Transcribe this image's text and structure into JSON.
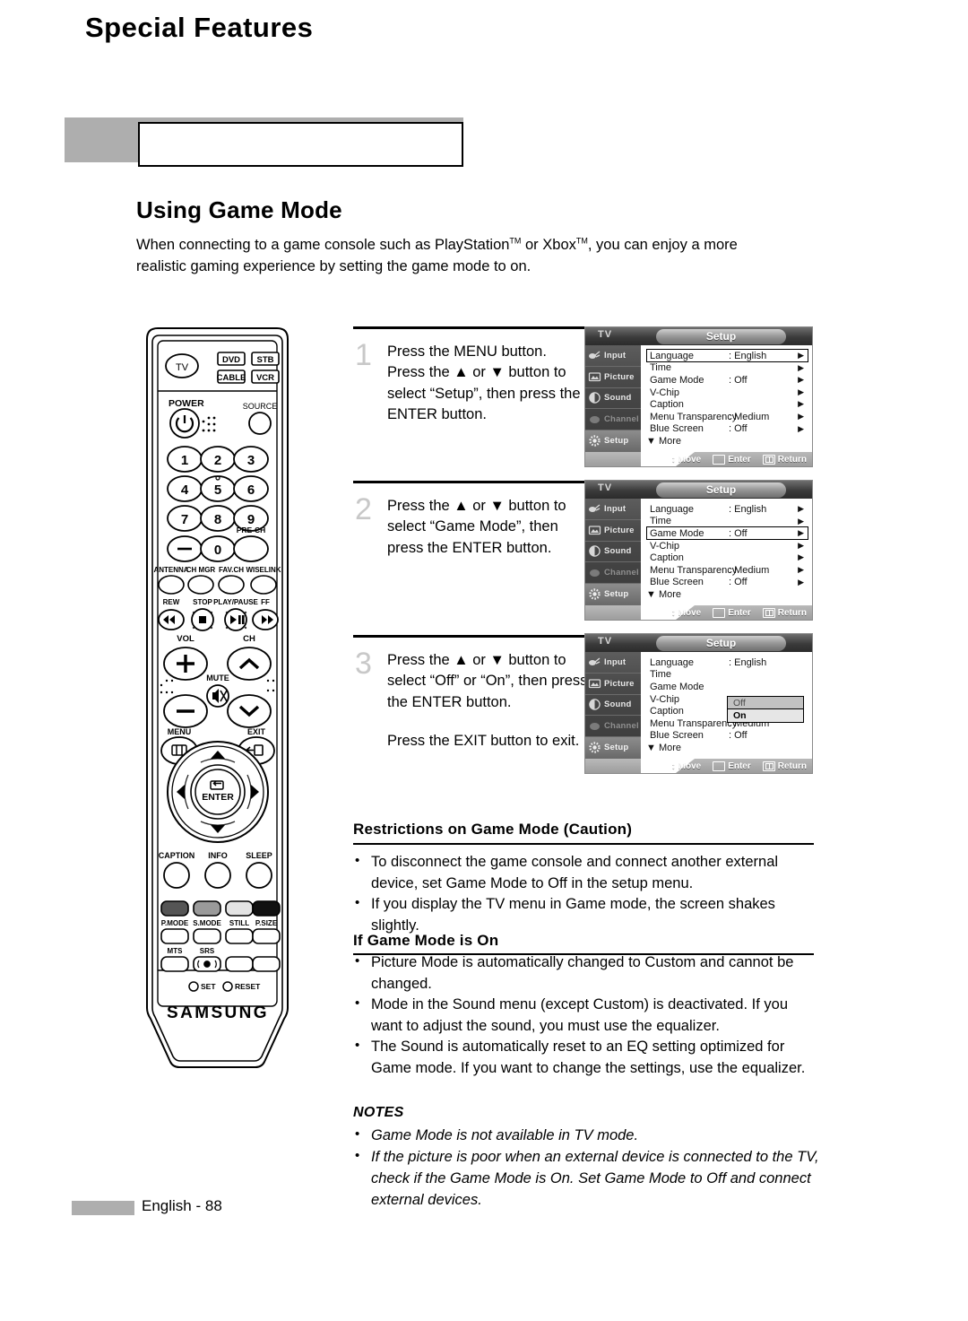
{
  "header": {
    "title": "Special Features"
  },
  "section": {
    "title": "Using Game Mode",
    "intro": "When connecting to a game console such as PlayStation™ or Xbox™, you can enjoy a more realistic gaming experience by setting the game mode to on."
  },
  "steps": [
    {
      "num": "1",
      "text": "Press the MENU button. Press the ▲ or ▼ button to select “Setup”, then press the ENTER button.",
      "extra": ""
    },
    {
      "num": "2",
      "text": "Press the ▲ or ▼ button to select “Game Mode”, then press the ENTER button.",
      "extra": ""
    },
    {
      "num": "3",
      "text": "Press the ▲ or ▼ button to select “Off” or “On”, then press the ENTER button.",
      "extra": "Press the EXIT button to exit."
    }
  ],
  "osd": {
    "device_label": "TV",
    "menu_title": "Setup",
    "sidebar": [
      {
        "label": "Input",
        "icon": "input-icon",
        "state": "normal"
      },
      {
        "label": "Picture",
        "icon": "picture-icon",
        "state": "normal"
      },
      {
        "label": "Sound",
        "icon": "sound-icon",
        "state": "normal"
      },
      {
        "label": "Channel",
        "icon": "channel-icon",
        "state": "dim"
      },
      {
        "label": "Setup",
        "icon": "setup-icon",
        "state": "active"
      }
    ],
    "rows": [
      {
        "label": "Language",
        "value": ": English"
      },
      {
        "label": "Time",
        "value": ""
      },
      {
        "label": "Game Mode",
        "value": ": Off"
      },
      {
        "label": "V-Chip",
        "value": ""
      },
      {
        "label": "Caption",
        "value": ""
      },
      {
        "label": "Menu Transparency",
        "value": ": Medium"
      },
      {
        "label": "Blue Screen",
        "value": ": Off"
      }
    ],
    "more_label": "▼ More",
    "footer": [
      {
        "glyph": "↕",
        "label": "Move"
      },
      {
        "glyph": "enter-box",
        "label": "Enter"
      },
      {
        "glyph": "return-box",
        "label": "Return"
      }
    ],
    "screen1_selected_index": 0,
    "screen2_selected_index": 2,
    "screen3_dropdown": {
      "options": [
        "Off",
        "On"
      ],
      "selected": "On"
    }
  },
  "restrictions": {
    "heading": "Restrictions on Game Mode (Caution)",
    "bullets": [
      "To disconnect the game console and connect another external device, set Game Mode to Off in the setup menu.",
      "If you display the TV menu in Game mode, the screen shakes slightly."
    ]
  },
  "game_mode_on": {
    "heading": "If Game Mode is On",
    "bullets": [
      "Picture Mode is automatically changed to Custom and cannot be changed.",
      "Mode in the Sound menu (except Custom) is deactivated. If you want to adjust the sound, you must use the equalizer.",
      "The Sound is automatically reset to an EQ setting optimized for Game mode. If you want to change the settings, use the equalizer."
    ]
  },
  "notes": {
    "heading": "NOTES",
    "bullets": [
      "Game Mode is not available in TV mode.",
      "If the picture is poor when an external device is connected to the TV, check if the Game Mode is On. Set Game Mode to Off and connect external devices."
    ]
  },
  "footer": {
    "page": "English - 88"
  },
  "remote": {
    "brand": "SAMSUNG",
    "device_buttons": [
      "TV",
      "DVD",
      "STB",
      "CABLE",
      "VCR"
    ],
    "power_label": "POWER",
    "source_label": "SOURCE",
    "keypad": [
      "1",
      "2",
      "3",
      "4",
      "5",
      "6",
      "7",
      "8",
      "9",
      "—",
      "0",
      ""
    ],
    "prech_label": "PRE-CH",
    "fn_row": [
      "ANTENNA",
      "CH MGR",
      "FAV.CH",
      "WISELINK"
    ],
    "transport": [
      "REW",
      "STOP",
      "PLAY/PAUSE",
      "FF"
    ],
    "vol_label": "VOL",
    "ch_label": "CH",
    "mute_label": "MUTE",
    "menu_label": "MENU",
    "exit_label": "EXIT",
    "enter_label": "ENTER",
    "lower_row": [
      "CAPTION",
      "INFO",
      "SLEEP"
    ],
    "color_row": [
      "P.MODE",
      "S.MODE",
      "STILL",
      "P.SIZE"
    ],
    "mts_label": "MTS",
    "srs_label": "SRS",
    "set_label": "SET",
    "reset_label": "RESET"
  }
}
